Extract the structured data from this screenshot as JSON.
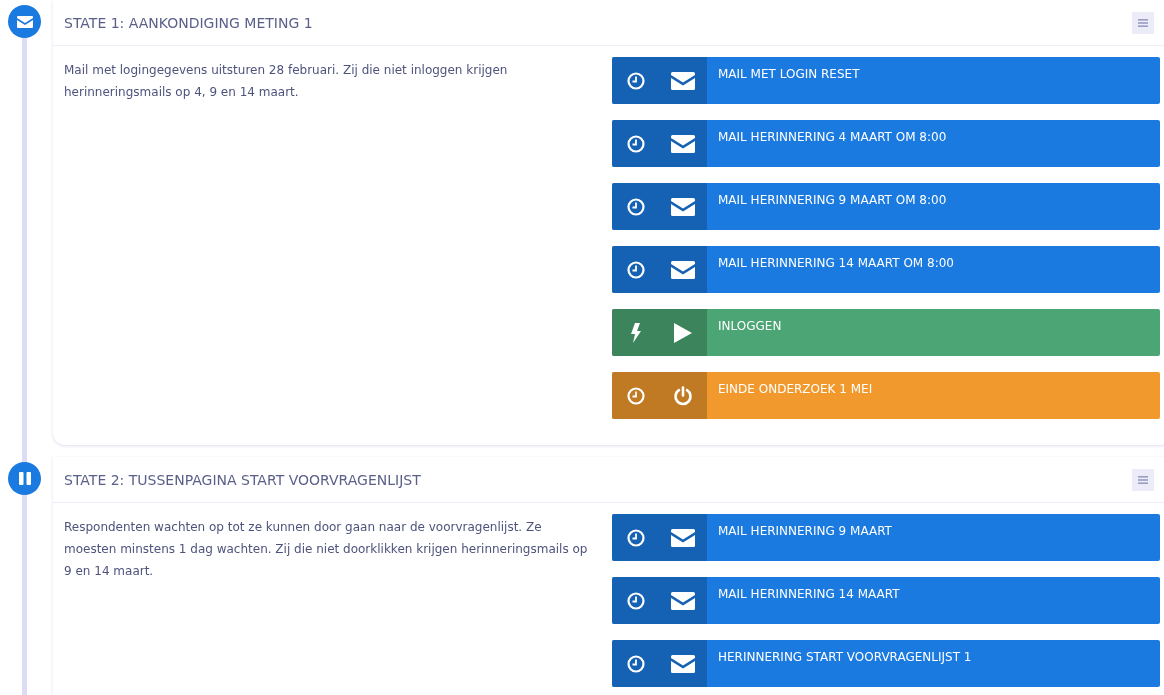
{
  "states": [
    {
      "kind": "mail",
      "title": "STATE 1: AANKONDIGING METING 1",
      "description": "Mail met logingegevens uitsturen 28 februari. Zij die niet inloggen krijgen herinneringsmails op 4, 9 en 14 maart.",
      "actions": [
        {
          "kind": "timed-mail",
          "color": "#1b7ae0",
          "label": "MAIL MET LOGIN RESET"
        },
        {
          "kind": "timed-mail",
          "color": "#1b7ae0",
          "label": "MAIL HERINNERING 4 MAART OM 8:00"
        },
        {
          "kind": "timed-mail",
          "color": "#1b7ae0",
          "label": "MAIL HERINNERING 9 MAART OM 8:00"
        },
        {
          "kind": "timed-mail",
          "color": "#1b7ae0",
          "label": "MAIL HERINNERING 14 MAART OM 8:00"
        },
        {
          "kind": "event-start",
          "color": "#4ca574",
          "label": "INLOGGEN"
        },
        {
          "kind": "timed-stop",
          "color": "#f2992e",
          "label": "EINDE ONDERZOEK 1 MEI"
        }
      ]
    },
    {
      "kind": "pause",
      "title": "STATE 2: TUSSENPAGINA START VOORVRAGENLIJST",
      "description": "Respondenten wachten op tot ze kunnen door gaan naar de voorvragenlijst. Ze moesten minstens 1 dag wachten. Zij die niet doorklikken krijgen herinneringsmails op 9 en 14 maart.",
      "actions": [
        {
          "kind": "timed-mail",
          "color": "#1b7ae0",
          "label": "MAIL HERINNERING 9 MAART"
        },
        {
          "kind": "timed-mail",
          "color": "#1b7ae0",
          "label": "MAIL HERINNERING 14 MAART"
        },
        {
          "kind": "timed-mail",
          "color": "#1b7ae0",
          "label": "HERINNERING START VOORVRAGENLIJST 1"
        }
      ]
    }
  ]
}
